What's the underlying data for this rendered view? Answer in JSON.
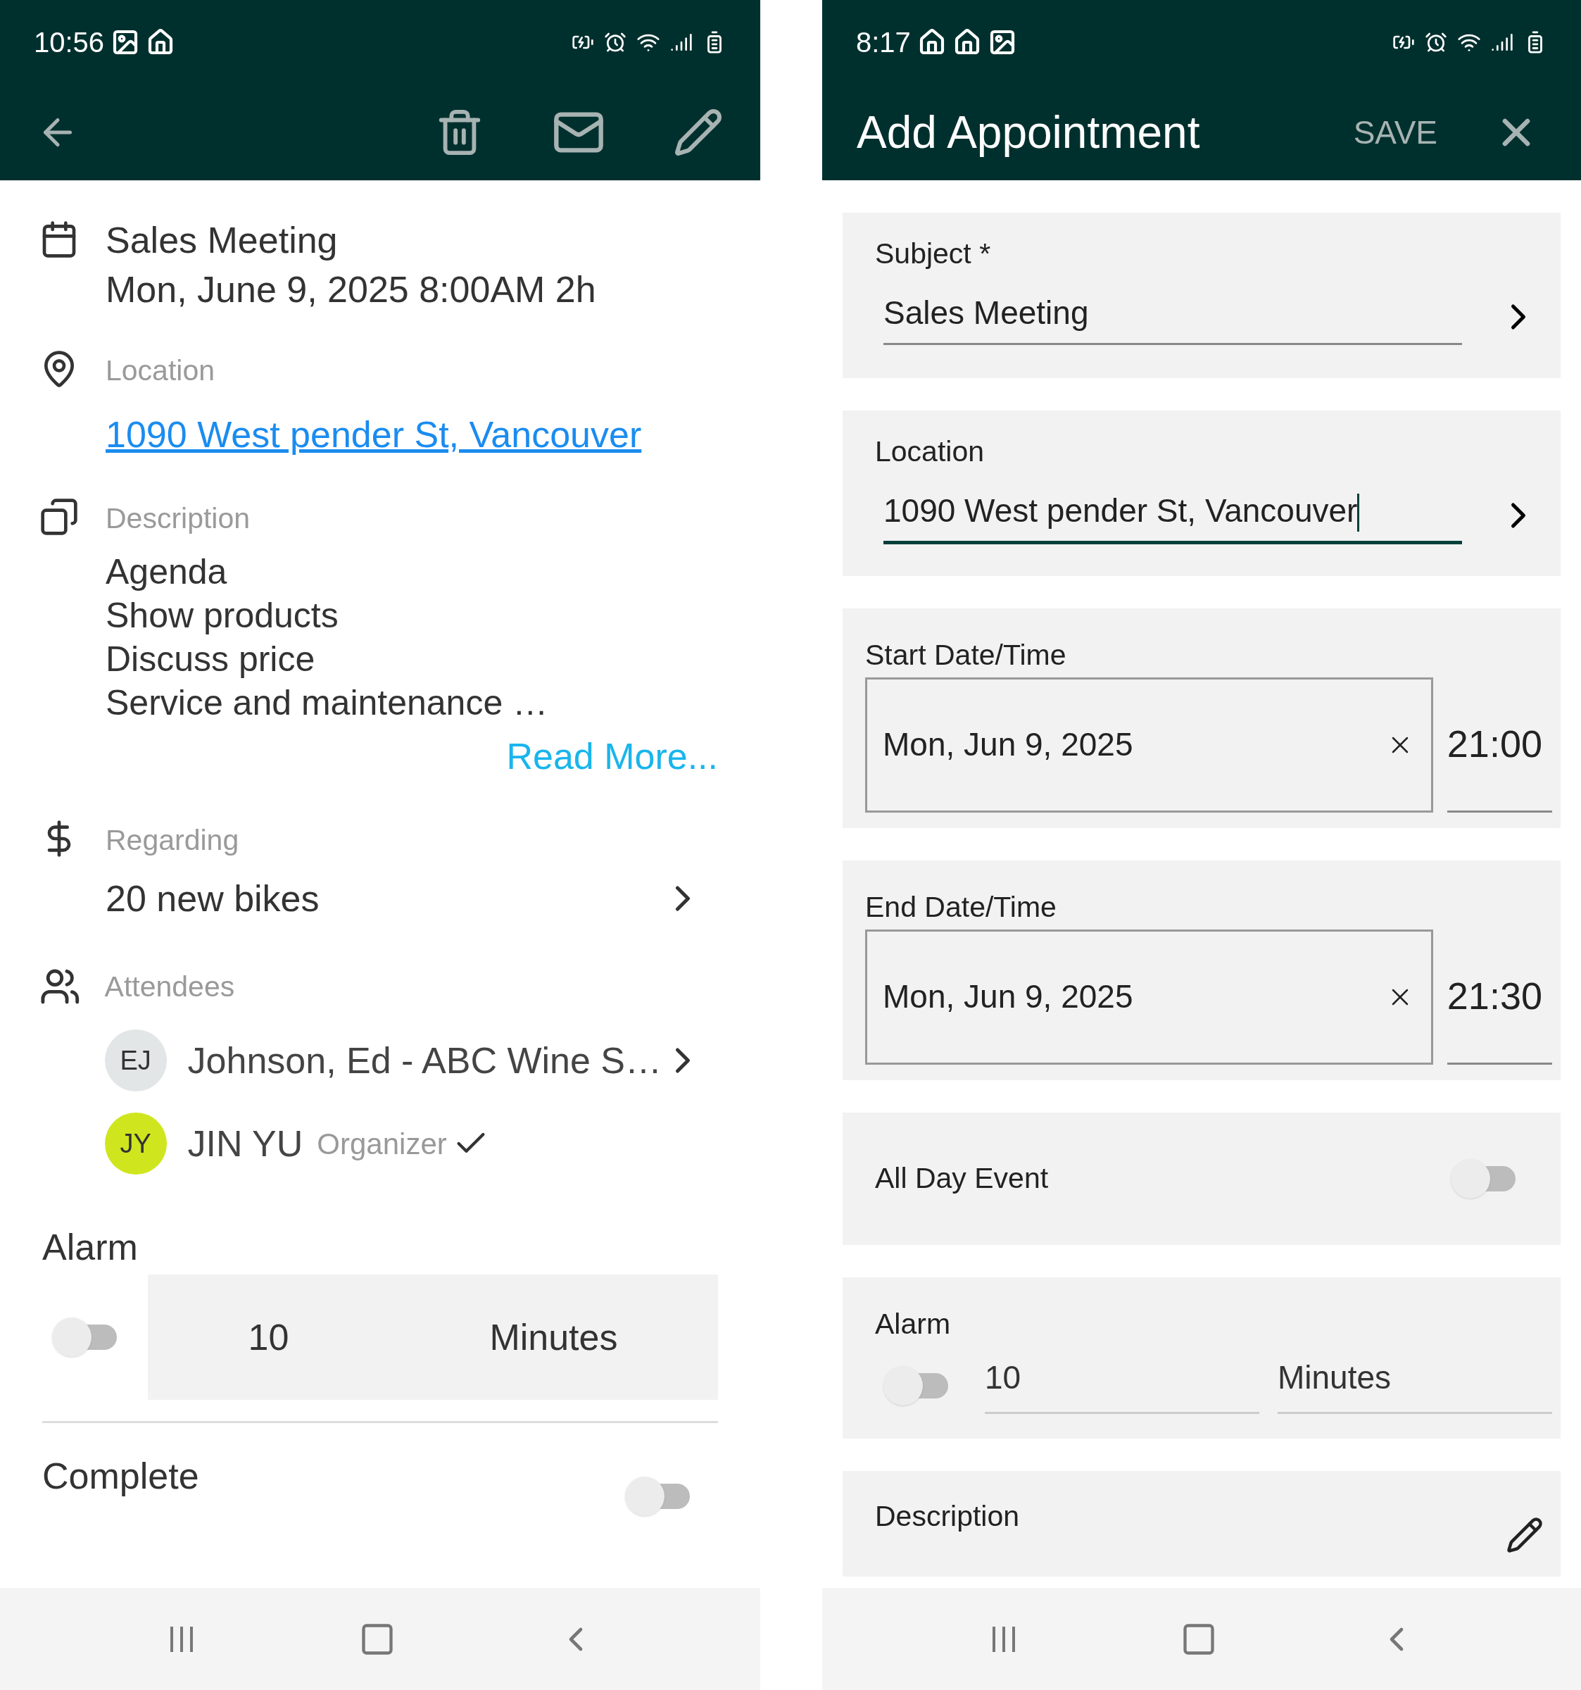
{
  "detail_screen": {
    "status_bar": {
      "time": "10:56"
    },
    "subject": "Sales Meeting",
    "when": "Mon, June 9, 2025 8:00AM 2h",
    "location": {
      "label": "Location",
      "value": "1090 West pender St, Vancouver"
    },
    "description": {
      "label": "Description",
      "lines": [
        "Agenda",
        "Show products",
        "Discuss price",
        "Service and maintenance …"
      ],
      "read_more": "Read More..."
    },
    "regarding": {
      "label": "Regarding",
      "value": "20 new bikes"
    },
    "attendees": {
      "label": "Attendees",
      "items": [
        {
          "initials": "EJ",
          "name": "Johnson, Ed - ABC Wine S…",
          "color": "#e2e6e6",
          "confirmed": false,
          "has_link": true
        },
        {
          "initials": "JY",
          "name": "JIN YU",
          "role": "Organizer",
          "color": "#cfe61e",
          "confirmed": true,
          "has_link": false
        }
      ]
    },
    "alarm": {
      "label": "Alarm",
      "on": false,
      "value": "10",
      "unit": "Minutes"
    },
    "complete": {
      "label": "Complete",
      "on": false
    }
  },
  "edit_screen": {
    "status_bar": {
      "time": "8:17"
    },
    "title": "Add Appointment",
    "save": "SAVE",
    "fields": [
      {
        "kind": "text",
        "label": "Subject *",
        "value": "Sales Meeting",
        "focused": false
      },
      {
        "kind": "text",
        "label": "Location",
        "value": "1090 West pender St, Vancouver",
        "focused": true
      },
      {
        "kind": "datetime",
        "label": "Start Date/Time",
        "date": "Mon, Jun 9, 2025",
        "time": "21:00"
      },
      {
        "kind": "datetime",
        "label": "End Date/Time",
        "date": "Mon, Jun 9, 2025",
        "time": "21:30"
      },
      {
        "kind": "toggle",
        "label": "All Day Event",
        "on": false
      },
      {
        "kind": "alarm",
        "label": "Alarm",
        "on": false,
        "value": "10",
        "unit": "Minutes"
      },
      {
        "kind": "description",
        "label": "Description"
      }
    ]
  }
}
